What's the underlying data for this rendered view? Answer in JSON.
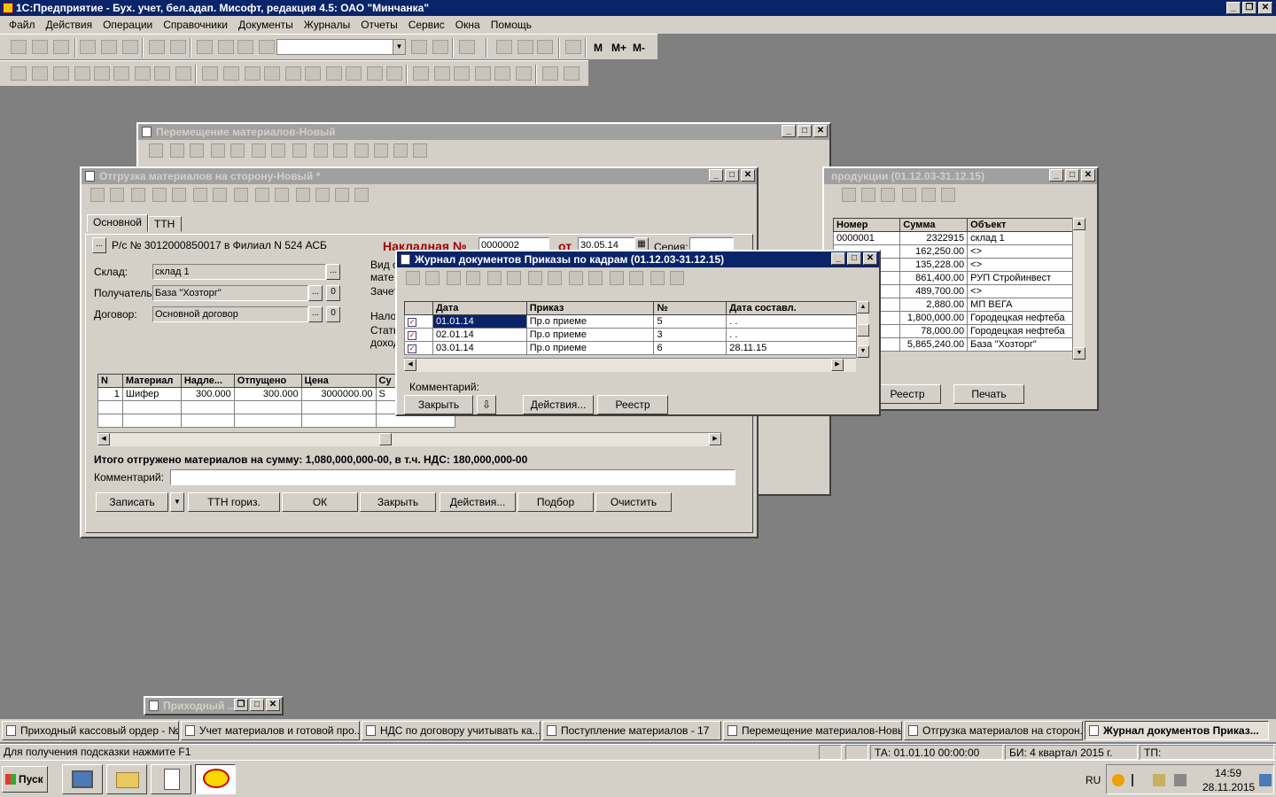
{
  "app": {
    "title": "1С:Предприятие - Бух. учет, бел.адап. Мисофт, редакция 4.5: ОАО \"Минчанка\""
  },
  "menu": [
    "Файл",
    "Действия",
    "Операции",
    "Справочники",
    "Документы",
    "Журналы",
    "Отчеты",
    "Сервис",
    "Окна",
    "Помощь"
  ],
  "toolbar": {
    "m_label": "M",
    "mplus_label": "M+",
    "mminus_label": "M-"
  },
  "win_move": {
    "title": "Перемещение материалов-Новый"
  },
  "win_prod": {
    "title": "продукции (01.12.03-31.12.15)",
    "columns": [
      "Номер",
      "Сумма",
      "Объект"
    ],
    "rows": [
      {
        "num": "0000001",
        "sum": "2322915",
        "obj": "склад 1"
      },
      {
        "num": "",
        "sum": "162,250.00",
        "obj": "<>"
      },
      {
        "num": "",
        "sum": "135,228.00",
        "obj": "<>"
      },
      {
        "num": "",
        "sum": "861,400.00",
        "obj": "РУП Стройинвест"
      },
      {
        "num": "",
        "sum": "489,700.00",
        "obj": "<>"
      },
      {
        "num": "",
        "sum": "2,880.00",
        "obj": "МП ВЕГА"
      },
      {
        "num": "",
        "sum": "1,800,000.00",
        "obj": "Городецкая нефтеба"
      },
      {
        "num": "",
        "sum": "78,000.00",
        "obj": "Городецкая нефтеба"
      },
      {
        "num": "",
        "sum": "5,865,240.00",
        "obj": "База \"Хозторг\""
      }
    ],
    "registry_btn": "Реестр",
    "print_btn": "Печать"
  },
  "win_ship": {
    "title": "Отгрузка материалов на сторону-Новый *",
    "tab_main": "Основной",
    "tab_ttn": "ТТН",
    "account": "Р/с № 3012000850017 в Филиал N 524 АСБ",
    "invoice_label": "Накладная №",
    "invoice_no": "0000002",
    "from_label": "от",
    "date": "30.05.14",
    "series_label": "Серия:",
    "warehouse_label": "Склад:",
    "warehouse": "склад 1",
    "receiver_label": "Получатель:",
    "receiver": "База \"Хозторг\"",
    "contract_label": "Договор:",
    "contract": "Основной договор",
    "zero1": "0",
    "zero2": "0",
    "kind_label": "Вид о",
    "mat_label": "мате",
    "credit_label": "Зачет",
    "tax_label": "Нало",
    "stat_label": "Стать",
    "income_label": "доход",
    "columns": [
      "N",
      "Материал",
      "Надле...",
      "Отпущено",
      "Цена",
      "Су"
    ],
    "rows": [
      {
        "n": "1",
        "mat": "Шифер",
        "due": "300.000",
        "released": "300.000",
        "price": "3000000.00",
        "sum": "S"
      }
    ],
    "total": "Итого отгружено материалов на сумму: 1,080,000,000-00, в т.ч. НДС: 180,000,000-00",
    "comment_label": "Комментарий:",
    "comment": "",
    "buttons": {
      "save": "Записать",
      "ttn": "ТТН гориз.",
      "ok": "ОК",
      "close": "Закрыть",
      "actions": "Действия...",
      "pick": "Подбор",
      "clear": "Очистить"
    }
  },
  "win_journal": {
    "title": "Журнал документов  Приказы по кадрам (01.12.03-31.12.15)",
    "columns": [
      "Дата",
      "Приказ",
      "№",
      "Дата составл."
    ],
    "rows": [
      {
        "date": "01.01.14",
        "order": "Пр.о приеме",
        "no": "5",
        "comp": ". ."
      },
      {
        "date": "02.01.14",
        "order": "Пр.о приеме",
        "no": "3",
        "comp": ". ."
      },
      {
        "date": "03.01.14",
        "order": "Пр.о приеме",
        "no": "6",
        "comp": "28.11.15"
      }
    ],
    "comment_label": "Комментарий:",
    "buttons": {
      "close": "Закрыть",
      "actions": "Действия...",
      "registry": "Реестр"
    }
  },
  "win_cash_min": {
    "title": "Приходный ..."
  },
  "window_tabs": [
    "Приходный кассовый ордер - №0...",
    "Учет материалов и готовой про...",
    "НДС по договору учитывать ка...",
    "Поступление материалов - 17",
    "Перемещение материалов-Новый",
    "Отгрузка материалов на сторон...",
    "Журнал документов  Приказ..."
  ],
  "status": {
    "hint": "Для получения подсказки нажмите F1",
    "ta": "ТА: 01.01.10  00:00:00",
    "bi": "БИ: 4 квартал 2015 г.",
    "tp": "ТП:"
  },
  "taskbar": {
    "start": "Пуск",
    "lang": "RU",
    "time": "14:59",
    "date": "28.11.2015"
  }
}
